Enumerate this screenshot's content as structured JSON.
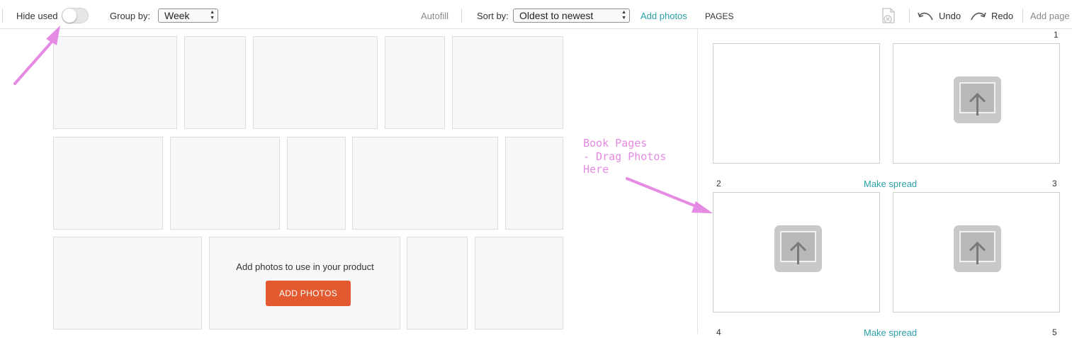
{
  "toolbar": {
    "hide_used_label": "Hide used",
    "hide_used_on": false,
    "group_by_label": "Group by:",
    "group_by_value": "Week",
    "autofill_label": "Autofill",
    "sort_by_label": "Sort by:",
    "sort_by_value": "Oldest to newest",
    "add_photos_label": "Add photos",
    "pages_label": "PAGES",
    "undo_label": "Undo",
    "redo_label": "Redo",
    "add_page_label": "Add page"
  },
  "library": {
    "empty_message": "Add photos to use in your product",
    "add_button_label": "ADD PHOTOS"
  },
  "pages": {
    "numbers": [
      "1",
      "2",
      "3",
      "4",
      "5"
    ],
    "make_spread_label": "Make spread"
  },
  "annotation": {
    "text": "Book Pages\n- Drag Photos\nHere"
  },
  "colors": {
    "accent": "#2aa1a8",
    "primary_button": "#e35a30",
    "annotation": "#e58be3"
  }
}
